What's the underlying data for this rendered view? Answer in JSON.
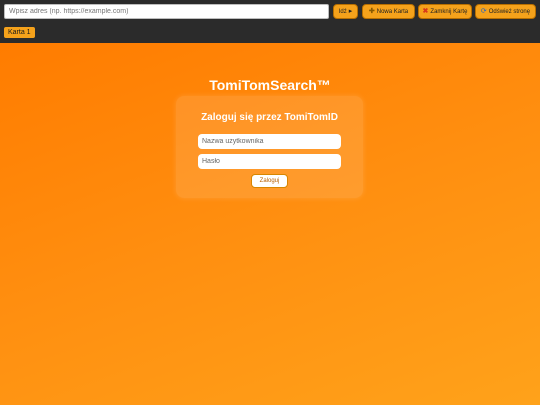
{
  "browser": {
    "url_placeholder": "Wpisz adres (np. https://example.com)",
    "url_value": "",
    "go_label": "Idź",
    "go_icon": "▸",
    "new_tab_label": "Nowa Karta",
    "new_tab_icon": "plus-icon",
    "close_tab_label": "Zamknij Kartę",
    "close_tab_icon": "close-icon",
    "refresh_label": "Odśwież stronę",
    "refresh_icon": "refresh-icon",
    "tabs": [
      {
        "label": "Karta 1",
        "active": true
      }
    ]
  },
  "page": {
    "title": "TomiTomSearch™",
    "login": {
      "heading": "Zaloguj się przez TomiTomID",
      "username_placeholder": "Nazwa użytkownika",
      "password_placeholder": "Hasło",
      "submit_label": "Zaloguj"
    }
  },
  "colors": {
    "accent": "#f5a21b",
    "toolbar_bg": "#2b2b2b",
    "page_bg": "#ff8a00"
  }
}
